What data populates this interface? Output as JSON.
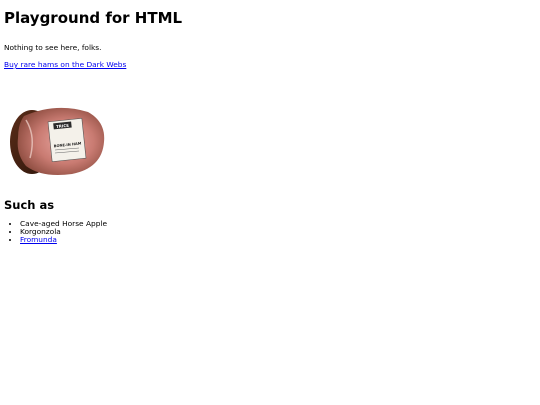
{
  "page": {
    "title": "Playground for HTML",
    "intro": "Nothing to see here, folks.",
    "link_text": "Buy rare hams on the Dark Webs"
  },
  "ham_image": {
    "label_top": "TRICE",
    "label_main": "BONE-IN HAM"
  },
  "section": {
    "heading": "Such as",
    "items": [
      {
        "text": "Cave-aged Horse Apple",
        "is_link": false
      },
      {
        "text": "Korgonzola",
        "is_link": false
      },
      {
        "text": "Fromunda",
        "is_link": true
      }
    ]
  },
  "colors": {
    "link": "#0000ee",
    "text": "#000000",
    "background": "#ffffff"
  }
}
